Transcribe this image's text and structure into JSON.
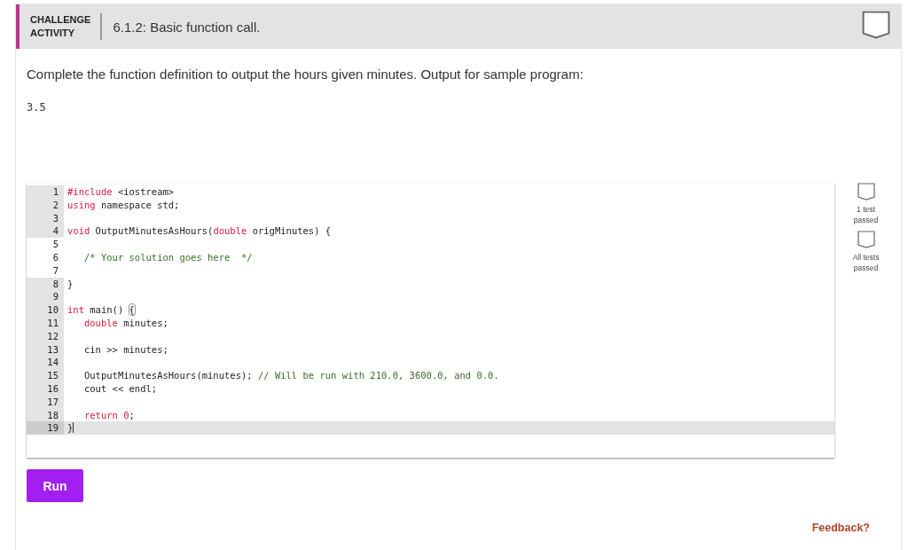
{
  "header": {
    "label_lines": [
      "CHALLENGE",
      "ACTIVITY"
    ],
    "title": "6.1.2: Basic function call."
  },
  "instructions": "Complete the function definition to output the hours given minutes. Output for sample program:",
  "sample_output": "3.5",
  "editor": {
    "lines": [
      {
        "number": "1",
        "editable": false,
        "current": false,
        "segments": [
          {
            "kind": "keyword",
            "text": "#include"
          },
          {
            "kind": "plain",
            "text": " <iostream>"
          }
        ]
      },
      {
        "number": "2",
        "editable": false,
        "current": false,
        "segments": [
          {
            "kind": "keyword",
            "text": "using"
          },
          {
            "kind": "plain",
            "text": " namespace std;"
          }
        ]
      },
      {
        "number": "3",
        "editable": false,
        "current": false
      },
      {
        "number": "4",
        "editable": false,
        "current": false,
        "segments": [
          {
            "kind": "keyword",
            "text": "void"
          },
          {
            "kind": "plain",
            "text": " OutputMinutesAsHours("
          },
          {
            "kind": "keyword",
            "text": "double"
          },
          {
            "kind": "plain",
            "text": " origMinutes) {"
          }
        ]
      },
      {
        "number": "5",
        "editable": true,
        "current": false
      },
      {
        "number": "6",
        "editable": true,
        "current": false,
        "segments": [
          {
            "kind": "comment",
            "text": "   /* Your solution goes here  */"
          }
        ]
      },
      {
        "number": "7",
        "editable": true,
        "current": false
      },
      {
        "number": "8",
        "editable": false,
        "current": false,
        "segments": [
          {
            "kind": "plain",
            "text": "}"
          }
        ]
      },
      {
        "number": "9",
        "editable": false,
        "current": false
      },
      {
        "number": "10",
        "editable": false,
        "current": false,
        "segments": [
          {
            "kind": "keyword",
            "text": "int"
          },
          {
            "kind": "plain",
            "text": " main() "
          },
          {
            "kind": "bracket",
            "text": "{"
          }
        ]
      },
      {
        "number": "11",
        "editable": false,
        "current": false,
        "segments": [
          {
            "kind": "keyword",
            "text": "   double"
          },
          {
            "kind": "plain",
            "text": " minutes;"
          }
        ]
      },
      {
        "number": "12",
        "editable": false,
        "current": false
      },
      {
        "number": "13",
        "editable": false,
        "current": false,
        "segments": [
          {
            "kind": "plain",
            "text": "   cin >> minutes;"
          }
        ]
      },
      {
        "number": "14",
        "editable": false,
        "current": false
      },
      {
        "number": "15",
        "editable": false,
        "current": false,
        "segments": [
          {
            "kind": "plain",
            "text": "   OutputMinutesAsHours(minutes); "
          },
          {
            "kind": "comment",
            "text": "// Will be run with 210.0, 3600.0, and 0.0."
          }
        ]
      },
      {
        "number": "16",
        "editable": false,
        "current": false,
        "segments": [
          {
            "kind": "plain",
            "text": "   cout << endl;"
          }
        ]
      },
      {
        "number": "17",
        "editable": false,
        "current": false
      },
      {
        "number": "18",
        "editable": false,
        "current": false,
        "segments": [
          {
            "kind": "keyword",
            "text": "   return 0"
          },
          {
            "kind": "plain",
            "text": ";"
          }
        ]
      },
      {
        "number": "19",
        "editable": false,
        "current": true,
        "segments": [
          {
            "kind": "plain",
            "text": "}"
          }
        ]
      }
    ]
  },
  "tests": [
    {
      "label_lines": [
        "1 test",
        "passed"
      ],
      "passed": false
    },
    {
      "label_lines": [
        "All tests",
        "passed"
      ],
      "passed": false
    }
  ],
  "run_button": "Run",
  "feedback_link": "Feedback?",
  "activity_completed": false
}
